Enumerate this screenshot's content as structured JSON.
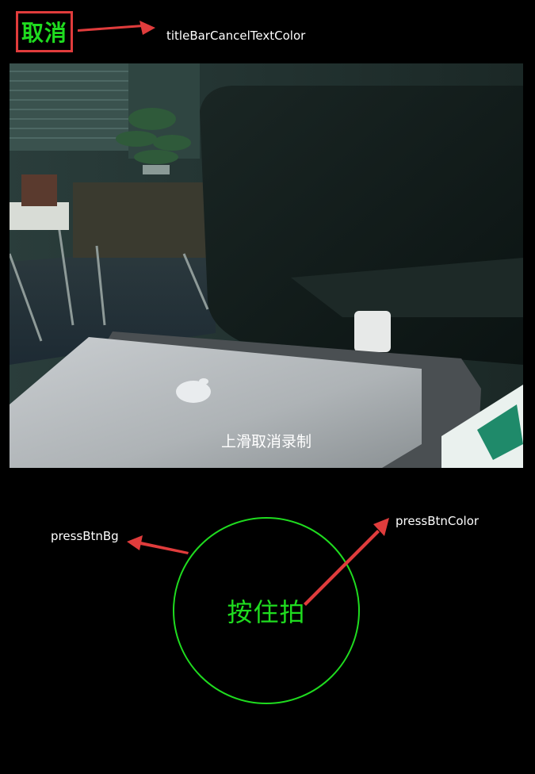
{
  "title_bar": {
    "cancel_label": "取消"
  },
  "annotations": {
    "cancel_color": "titleBarCancelTextColor",
    "press_bg": "pressBtnBg",
    "press_color": "pressBtnColor"
  },
  "preview": {
    "hint": "上滑取消录制"
  },
  "press_button": {
    "label": "按住拍"
  },
  "colors": {
    "accent_green": "#1fdc1f",
    "annotation_red": "#e03c3c",
    "background": "#000000"
  }
}
